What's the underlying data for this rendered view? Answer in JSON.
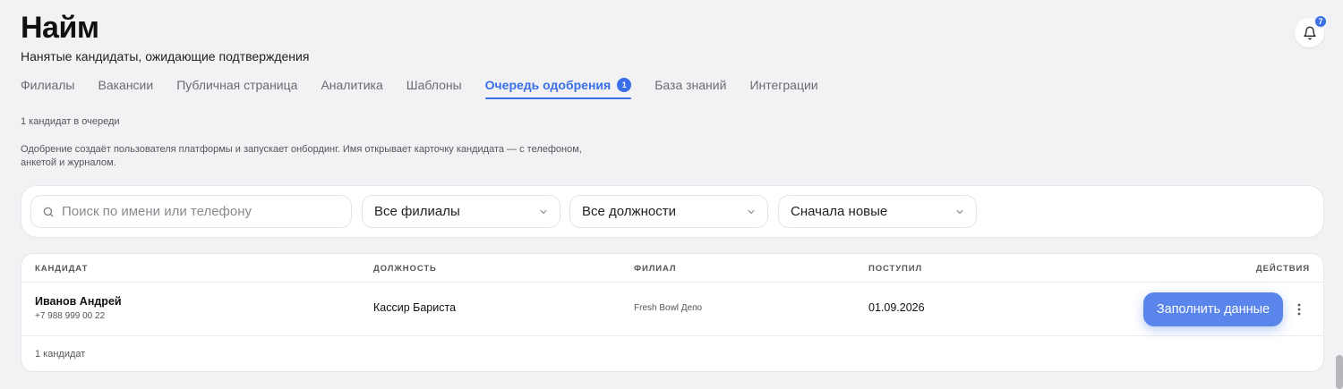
{
  "header": {
    "title": "Найм",
    "subtitle": "Нанятые кандидаты, ожидающие подтверждения",
    "notifications_count": "7"
  },
  "tabs": [
    {
      "label": "Филиалы"
    },
    {
      "label": "Вакансии"
    },
    {
      "label": "Публичная страница"
    },
    {
      "label": "Аналитика"
    },
    {
      "label": "Шаблоны"
    },
    {
      "label": "Очередь одобрения",
      "badge": "1",
      "active": true
    },
    {
      "label": "База знаний"
    },
    {
      "label": "Интеграции"
    }
  ],
  "queue": {
    "count_text": "1 кандидат в очереди",
    "info_text": "Одобрение создаёт пользователя платформы и запускает онбординг. Имя открывает карточку кандидата — с телефоном, анкетой и журналом."
  },
  "filters": {
    "search_placeholder": "Поиск по имени или телефону",
    "branch_select": "Все филиалы",
    "position_select": "Все должности",
    "sort_select": "Сначала новые"
  },
  "table": {
    "columns": {
      "candidate": "КАНДИДАТ",
      "position": "ДОЛЖНОСТЬ",
      "branch": "ФИЛИАЛ",
      "received": "ПОСТУПИЛ",
      "actions": "ДЕЙСТВИЯ"
    },
    "rows": [
      {
        "name": "Иванов Андрей",
        "phone": "+7 988 999 00 22",
        "position": "Кассир Бариста",
        "branch": "Fresh Bowl Депо",
        "received": "01.09.2026",
        "action_label": "Заполнить данные"
      }
    ],
    "footer": "1 кандидат"
  },
  "colors": {
    "accent": "#3a6fe8",
    "button": "#5a85ea",
    "background": "#f2f2f4"
  },
  "icons": {
    "bell": "bell-icon",
    "search": "search-icon",
    "chevron": "chevron-down-icon",
    "more": "more-vertical-icon"
  }
}
